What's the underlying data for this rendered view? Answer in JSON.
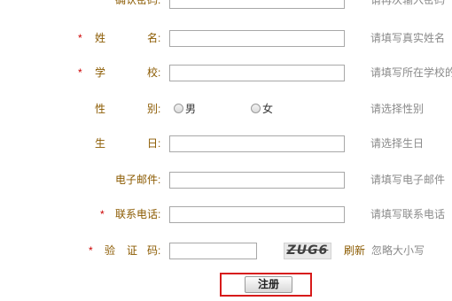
{
  "required_mark": "*",
  "fields": {
    "confirm_password": {
      "label": "确认密码:",
      "hint": "请再次输入密码",
      "value": ""
    },
    "real_name": {
      "label_a": "姓",
      "label_b": "名:",
      "hint": "请填写真实姓名",
      "value": ""
    },
    "school": {
      "label_a": "学",
      "label_b": "校:",
      "hint": "请填写所在学校的",
      "value": ""
    },
    "gender": {
      "label_a": "性",
      "label_b": "别:",
      "options": [
        "男",
        "女"
      ],
      "hint": "请选择性别"
    },
    "birthday": {
      "label_a": "生",
      "label_b": "日:",
      "hint": "请选择生日",
      "value": ""
    },
    "email": {
      "label": "电子邮件:",
      "hint": "请填写电子邮件",
      "value": ""
    },
    "phone": {
      "label": "联系电话:",
      "hint": "请填写联系电话",
      "value": ""
    },
    "captcha": {
      "label_a": "验",
      "label_b": "证",
      "label_c": "码:",
      "image_text": "ZUG6",
      "refresh_label": "刷新",
      "hint": "忽略大小写",
      "value": ""
    }
  },
  "submit_label": "注册",
  "colors": {
    "label": "#8b5a00",
    "required": "#cc0000",
    "hint": "#8a8a8a",
    "highlight": "#d71a1a"
  }
}
